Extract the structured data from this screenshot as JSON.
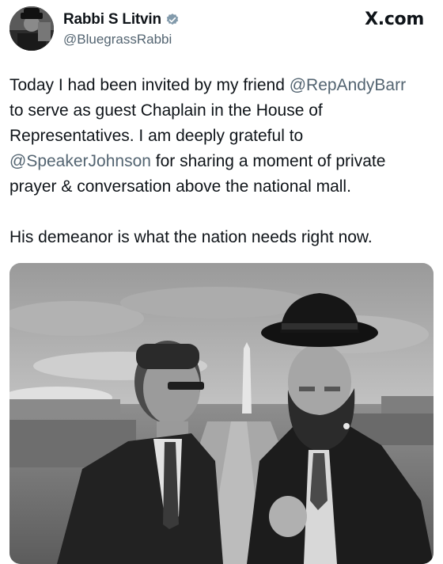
{
  "author": {
    "display_name": "Rabbi S Litvin",
    "handle": "@BluegrassRabbi",
    "verified_icon": "verified-badge-icon",
    "avatar_icon": "profile-photo"
  },
  "brand": {
    "label": "X.com",
    "icon": "x-logo-icon"
  },
  "tweet": {
    "line1_a": "Today I had been invited by my friend ",
    "mention1": "@RepAndyBarr",
    "line2": "to serve as guest Chaplain in the House of",
    "line3": "Representatives. I am deeply grateful to",
    "mention2": "@SpeakerJohnson",
    "line4_b": " for sharing a moment of private",
    "line5": "prayer & conversation above the national mall.",
    "line6": "His demeanor is what the nation needs right now."
  },
  "media": {
    "type": "photo",
    "style": "black-and-white",
    "subject": "two-men-balcony-national-mall"
  },
  "colors": {
    "text": "#0f1419",
    "secondary": "#536471",
    "background": "#ffffff",
    "verified_gray": "#829aab"
  }
}
